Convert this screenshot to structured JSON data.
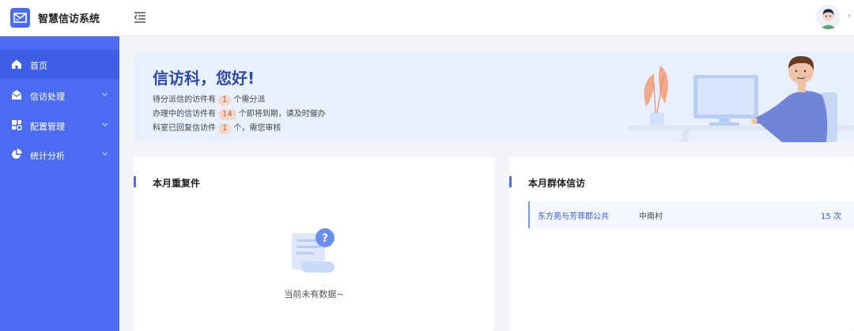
{
  "app": {
    "title": "智慧信访系统"
  },
  "sidebar": {
    "items": [
      {
        "label": "首页",
        "icon": "home-icon",
        "active": true
      },
      {
        "label": "信访处理",
        "icon": "mail-icon",
        "expandable": true
      },
      {
        "label": "配置管理",
        "icon": "config-icon",
        "expandable": true
      },
      {
        "label": "统计分析",
        "icon": "pie-chart-icon",
        "expandable": true
      }
    ]
  },
  "banner": {
    "greeting": "信访科，您好!",
    "line1": {
      "prefix": "待分派信的访件有",
      "count": "1",
      "suffix": "个需分派"
    },
    "line2": {
      "prefix": "办理中的信访件有",
      "count": "14",
      "suffix": "个即将到期，请及时催办"
    },
    "line3": {
      "prefix": "科室已回复信访件",
      "count": "1",
      "suffix": "个，需您审核"
    }
  },
  "cards": {
    "repeat": {
      "title": "本月重复件",
      "empty_text": "当前未有数据~"
    },
    "group": {
      "title": "本月群体信访",
      "rows": [
        {
          "name": "东方苑与芳菲郡公共",
          "village": "中南村",
          "count": "15 次"
        }
      ]
    }
  },
  "colors": {
    "primary": "#4b6cf0",
    "sidebar_active": "#3e5fe3",
    "banner_bg": "#e8f0fd",
    "badge_bg": "#f5d8cc"
  }
}
